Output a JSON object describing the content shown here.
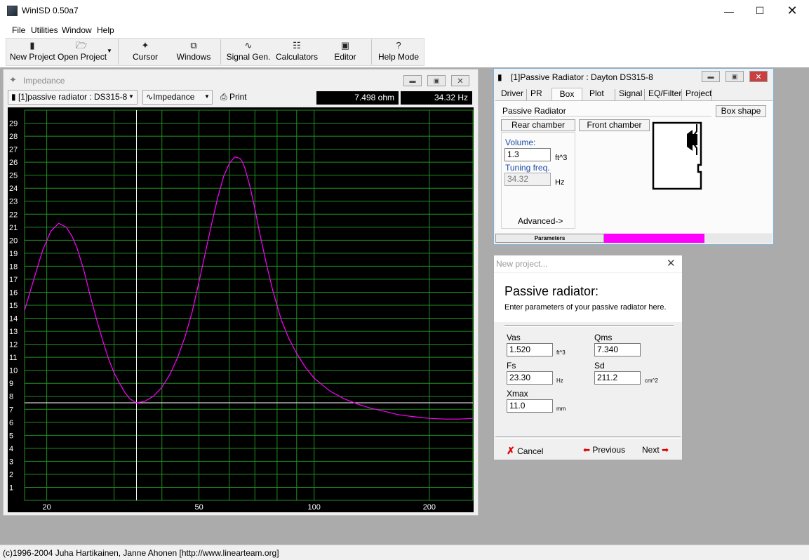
{
  "window": {
    "title": "WinISD 0.50a7"
  },
  "menu": {
    "items": [
      {
        "label": "File",
        "key": "F"
      },
      {
        "label": "Utilities",
        "key": "U"
      },
      {
        "label": "Window",
        "key": "W"
      },
      {
        "label": "Help",
        "key": "H"
      }
    ]
  },
  "toolbar": {
    "new_project": "New Project",
    "open_project": "Open Project",
    "cursor": "Cursor",
    "windows": "Windows",
    "signal_gen": "Signal Gen.",
    "calculators": "Calculators",
    "editor": "Editor",
    "help_mode": "Help Mode"
  },
  "impedance_window": {
    "title": "Impedance",
    "project_combo": "[1]passive radiator : DS315-8",
    "plot_combo": "Impedance",
    "print": "Print",
    "readout_ohm": "7.498 ohm",
    "readout_hz": "34.32 Hz"
  },
  "chart_data": {
    "type": "line",
    "title": "",
    "xlabel": "",
    "ylabel": "",
    "x_scale": "log",
    "xlim": [
      17.5,
      260
    ],
    "ylim": [
      0,
      30
    ],
    "x_tick_labels": [
      "20",
      "50",
      "100",
      "200"
    ],
    "y_tick_labels": [
      "1",
      "2",
      "3",
      "4",
      "5",
      "6",
      "7",
      "8",
      "9",
      "10",
      "11",
      "12",
      "13",
      "14",
      "15",
      "16",
      "17",
      "18",
      "19",
      "20",
      "21",
      "22",
      "23",
      "24",
      "25",
      "26",
      "27",
      "28",
      "29"
    ],
    "grid": true,
    "cursor": {
      "x": 34.32,
      "y": 7.498
    },
    "series": [
      {
        "color": "#ff00ff",
        "x": [
          17.5,
          18.5,
          19.5,
          20.5,
          21.5,
          22.5,
          23.3,
          24,
          25,
          26,
          27,
          28,
          29,
          30,
          31,
          32,
          33,
          34.32,
          36,
          38,
          40,
          42,
          44,
          46,
          48,
          50,
          52,
          54,
          56,
          58,
          60,
          62,
          64,
          65,
          66,
          68,
          70,
          72,
          75,
          78,
          82,
          86,
          90,
          95,
          100,
          110,
          120,
          130,
          140,
          150,
          165,
          180,
          200,
          220,
          240,
          260
        ],
        "y": [
          14.6,
          17.0,
          19.2,
          20.7,
          21.3,
          21.0,
          20.3,
          19.4,
          17.7,
          15.7,
          13.9,
          12.3,
          10.9,
          9.8,
          9.0,
          8.3,
          7.8,
          7.5,
          7.6,
          8.0,
          8.7,
          9.7,
          11.0,
          12.6,
          14.5,
          16.8,
          19.1,
          21.3,
          23.3,
          24.9,
          25.9,
          26.4,
          26.3,
          26.0,
          25.5,
          24.1,
          22.4,
          20.6,
          18.2,
          16.1,
          13.9,
          12.4,
          11.3,
          10.2,
          9.4,
          8.4,
          7.8,
          7.4,
          7.1,
          6.9,
          6.6,
          6.45,
          6.3,
          6.25,
          6.25,
          6.3
        ]
      }
    ]
  },
  "pr_window": {
    "title": "[1]Passive Radiator : Dayton DS315-8",
    "tabs": [
      "Driver",
      "PR",
      "Box",
      "Plot",
      "Signal",
      "EQ/Filter",
      "Project"
    ],
    "active_tab": "Box",
    "box_type": "Passive Radiator",
    "box_shape_btn": "Box shape",
    "rear_chamber_btn": "Rear chamber",
    "front_chamber_btn": "Front chamber",
    "volume_label": "Volume:",
    "volume_value": "1.3",
    "volume_unit": "ft^3",
    "tuning_label": "Tuning freq.",
    "tuning_value": "34.32",
    "tuning_unit": "Hz",
    "advanced": "Advanced->",
    "parameters_label": "Parameters",
    "progress_fraction": 0.6,
    "progress_color": "#ff00ff"
  },
  "new_project_dialog": {
    "title": "New project...",
    "heading": "Passive radiator:",
    "subheading": "Enter parameters of your passive radiator here.",
    "vas_label": "Vas",
    "vas_value": "1.520",
    "vas_unit": "ft^3",
    "qms_label": "Qms",
    "qms_value": "7.340",
    "fs_label": "Fs",
    "fs_value": "23.30",
    "fs_unit": "Hz",
    "sd_label": "Sd",
    "sd_value": "211.2",
    "sd_unit": "cm^2",
    "xmax_label": "Xmax",
    "xmax_value": "11.0",
    "xmax_unit": "mm",
    "cancel": "Cancel",
    "previous": "Previous",
    "next": "Next"
  },
  "status": {
    "text": "(c)1996-2004 Juha Hartikainen, Janne Ahonen [http://www.linearteam.org]"
  }
}
